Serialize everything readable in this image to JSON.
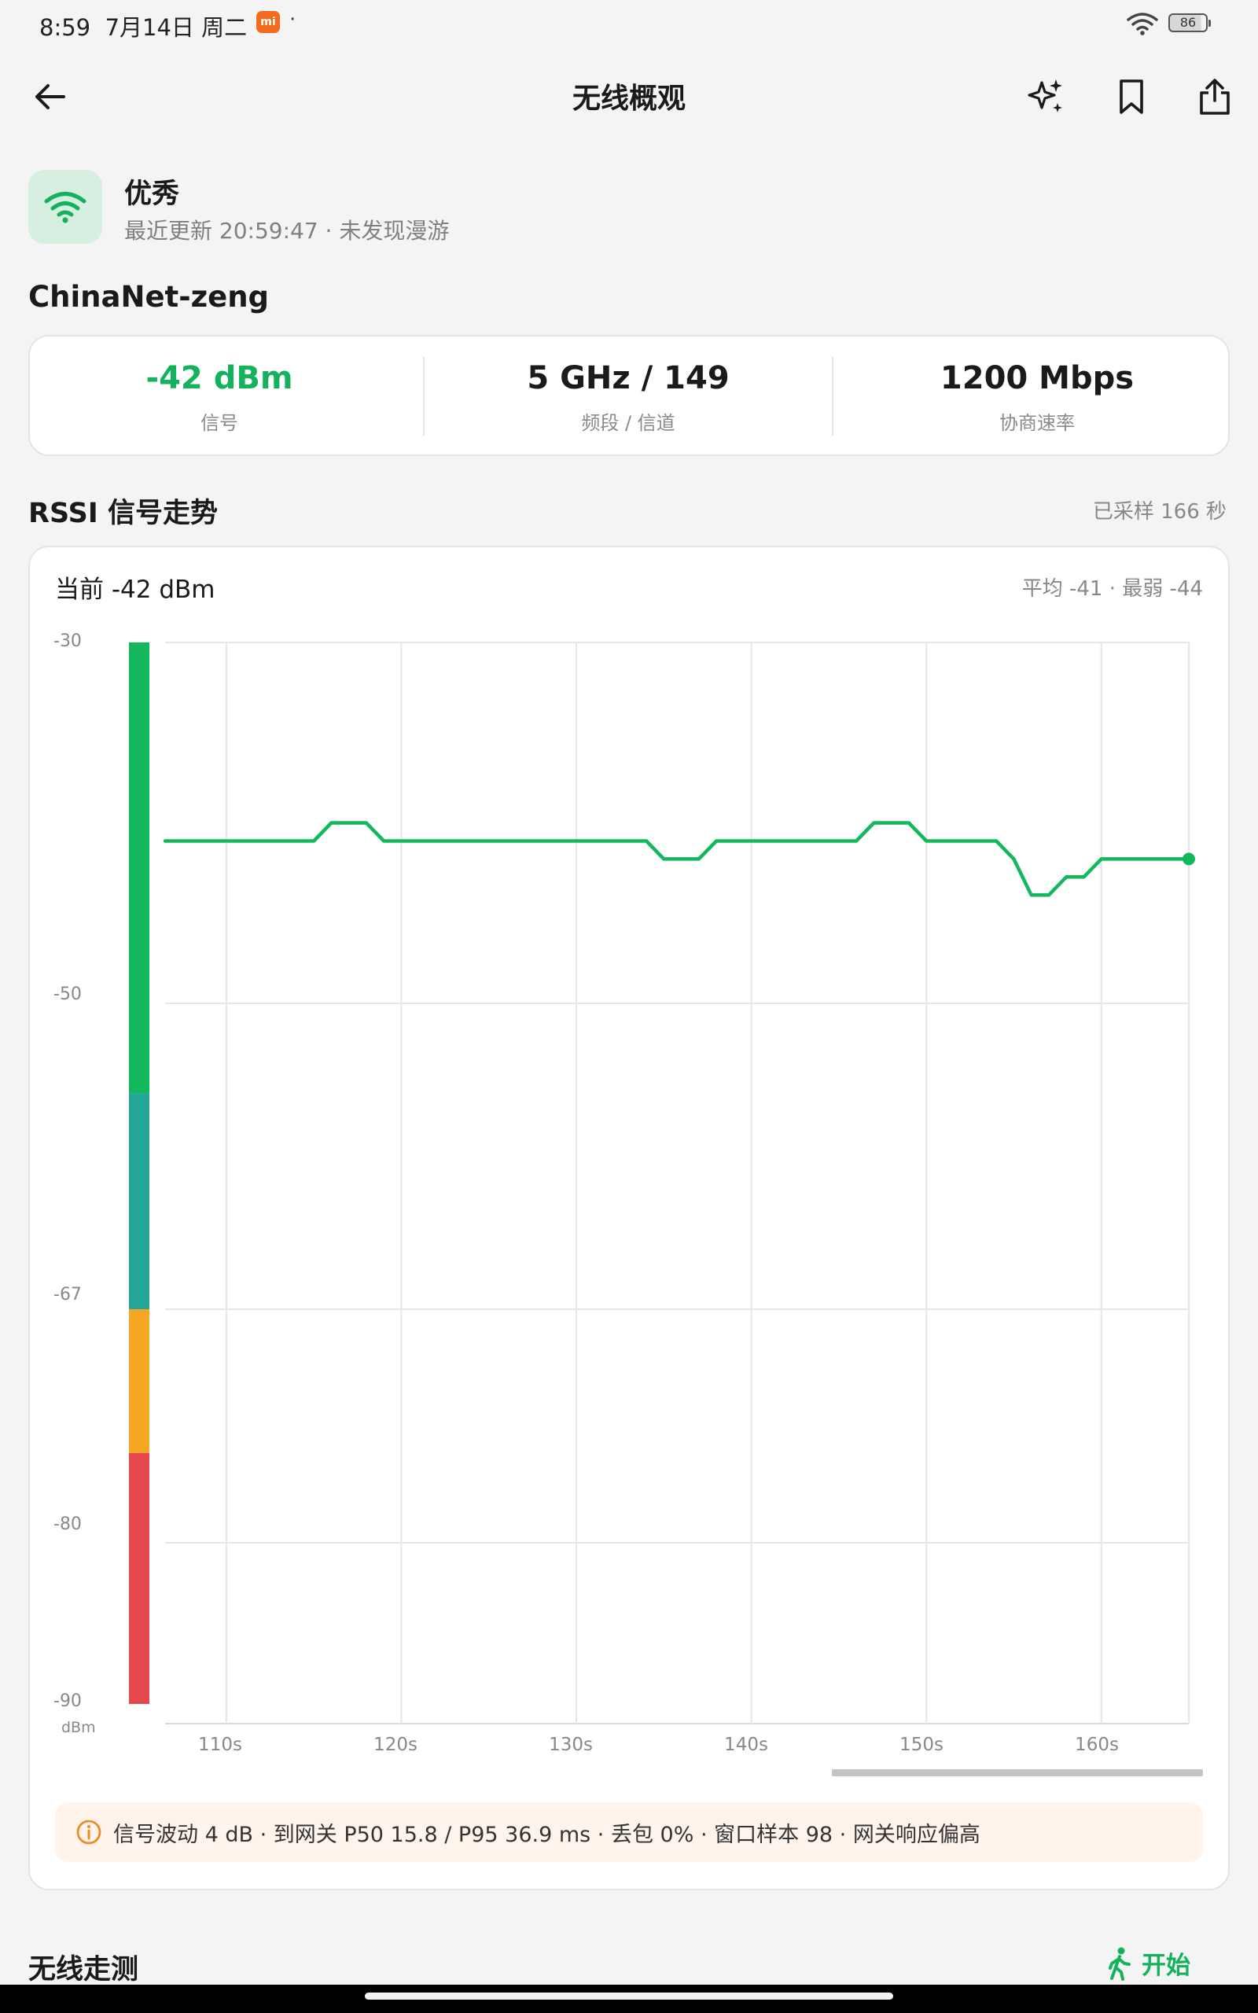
{
  "status_bar": {
    "time": "8:59",
    "date": "7月14日 周二",
    "app_badge": "mi",
    "dot": "·",
    "battery": "86"
  },
  "header": {
    "title": "无线概观"
  },
  "summary": {
    "quality": "优秀",
    "subline": "最近更新 20:59:47 · 未发现漫游"
  },
  "network": {
    "ssid": "ChinaNet-zeng"
  },
  "stats": [
    {
      "value": "-42 dBm",
      "label": "信号"
    },
    {
      "value": "5 GHz / 149",
      "label": "频段 / 信道"
    },
    {
      "value": "1200 Mbps",
      "label": "协商速率"
    }
  ],
  "rssi": {
    "title": "RSSI 信号走势",
    "sampled": "已采样 166 秒",
    "current": "当前 -42 dBm",
    "avg_min": "平均 -41 · 最弱 -44",
    "unit": "dBm"
  },
  "notice": {
    "text": "信号波动 4 dB · 到网关 P50 15.8 / P95 36.9 ms · 丢包 0% · 窗口样本 98 · 网关响应偏高"
  },
  "walk": {
    "title": "无线走测",
    "start_label": "开始"
  },
  "colors": {
    "accent": "#14b25c",
    "excellent": "#14b85c",
    "good": "#26a69a",
    "fair": "#f5a623",
    "poor": "#e5484d"
  },
  "chart_data": {
    "type": "line",
    "xlabel": "",
    "ylabel": "dBm",
    "xlim": [
      106.5,
      165
    ],
    "ylim": [
      -90,
      -30
    ],
    "x_ticks": [
      110,
      120,
      130,
      140,
      150,
      160
    ],
    "x_tick_labels": [
      "110s",
      "120s",
      "130s",
      "140s",
      "150s",
      "160s"
    ],
    "y_ticks": [
      -30,
      -50,
      -67,
      -80,
      -90
    ],
    "quality_bands": [
      {
        "from": -30,
        "to": -55,
        "color": "#14b85c"
      },
      {
        "from": -55,
        "to": -67,
        "color": "#26a69a"
      },
      {
        "from": -67,
        "to": -75,
        "color": "#f5a623"
      },
      {
        "from": -75,
        "to": -90,
        "color": "#e5484d"
      }
    ],
    "series": [
      {
        "color": "#14b85c",
        "x": [
          106.5,
          115,
          116,
          118,
          119,
          134,
          135,
          137,
          138,
          146,
          147,
          149,
          150,
          154,
          155,
          156,
          157,
          158,
          159,
          160,
          161,
          165
        ],
        "y": [
          -41,
          -41,
          -40,
          -40,
          -41,
          -41,
          -42,
          -42,
          -41,
          -41,
          -40,
          -40,
          -41,
          -41,
          -42,
          -44,
          -44,
          -43,
          -43,
          -42,
          -42,
          -42
        ]
      }
    ]
  }
}
